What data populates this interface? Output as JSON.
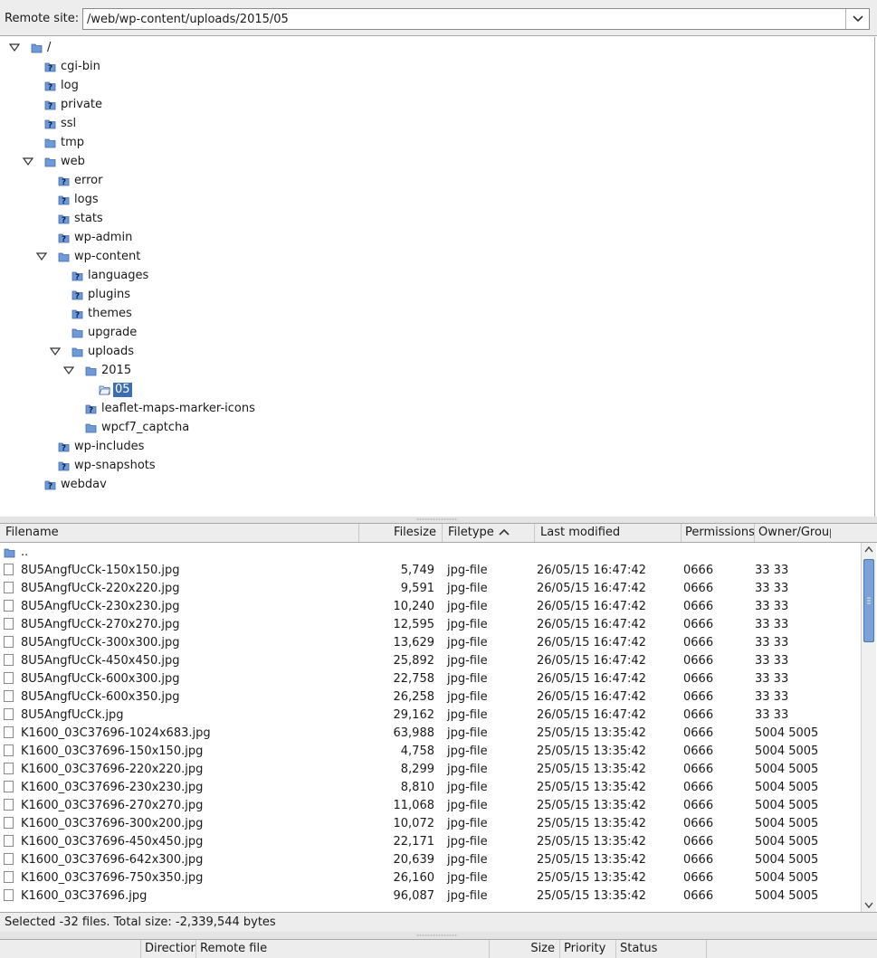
{
  "remote_site": {
    "label": "Remote site:",
    "path": "/web/wp-content/uploads/2015/05"
  },
  "tree": [
    {
      "label": "/",
      "level": 0,
      "expanded": true,
      "icon": "folder-icon"
    },
    {
      "label": "cgi-bin",
      "level": 1,
      "icon": "folder-unknown-icon"
    },
    {
      "label": "log",
      "level": 1,
      "icon": "folder-unknown-icon"
    },
    {
      "label": "private",
      "level": 1,
      "icon": "folder-unknown-icon"
    },
    {
      "label": "ssl",
      "level": 1,
      "icon": "folder-unknown-icon"
    },
    {
      "label": "tmp",
      "level": 1,
      "icon": "folder-icon"
    },
    {
      "label": "web",
      "level": 1,
      "expanded": true,
      "icon": "folder-icon"
    },
    {
      "label": "error",
      "level": 2,
      "icon": "folder-unknown-icon"
    },
    {
      "label": "logs",
      "level": 2,
      "icon": "folder-unknown-icon"
    },
    {
      "label": "stats",
      "level": 2,
      "icon": "folder-unknown-icon"
    },
    {
      "label": "wp-admin",
      "level": 2,
      "icon": "folder-unknown-icon"
    },
    {
      "label": "wp-content",
      "level": 2,
      "expanded": true,
      "icon": "folder-icon"
    },
    {
      "label": "languages",
      "level": 3,
      "icon": "folder-unknown-icon"
    },
    {
      "label": "plugins",
      "level": 3,
      "icon": "folder-unknown-icon"
    },
    {
      "label": "themes",
      "level": 3,
      "icon": "folder-unknown-icon"
    },
    {
      "label": "upgrade",
      "level": 3,
      "icon": "folder-icon"
    },
    {
      "label": "uploads",
      "level": 3,
      "expanded": true,
      "icon": "folder-icon"
    },
    {
      "label": "2015",
      "level": 4,
      "expanded": true,
      "icon": "folder-icon"
    },
    {
      "label": "05",
      "level": 5,
      "selected": true,
      "icon": "folder-open-icon"
    },
    {
      "label": "leaflet-maps-marker-icons",
      "level": 4,
      "icon": "folder-unknown-icon"
    },
    {
      "label": "wpcf7_captcha",
      "level": 4,
      "icon": "folder-icon"
    },
    {
      "label": "wp-includes",
      "level": 2,
      "icon": "folder-unknown-icon"
    },
    {
      "label": "wp-snapshots",
      "level": 2,
      "icon": "folder-unknown-icon"
    },
    {
      "label": "webdav",
      "level": 1,
      "icon": "folder-unknown-icon"
    }
  ],
  "file_list": {
    "columns": {
      "filename": "Filename",
      "filesize": "Filesize",
      "filetype": "Filetype",
      "last_modified": "Last modified",
      "permissions": "Permissions",
      "owner_group": "Owner/Group"
    },
    "parent_row": "..",
    "rows": [
      {
        "name": "8U5AngfUcCk-150x150.jpg",
        "size": "5,749",
        "type": "jpg-file",
        "modified": "26/05/15 16:47:42",
        "perm": "0666",
        "owner": "33 33"
      },
      {
        "name": "8U5AngfUcCk-220x220.jpg",
        "size": "9,591",
        "type": "jpg-file",
        "modified": "26/05/15 16:47:42",
        "perm": "0666",
        "owner": "33 33"
      },
      {
        "name": "8U5AngfUcCk-230x230.jpg",
        "size": "10,240",
        "type": "jpg-file",
        "modified": "26/05/15 16:47:42",
        "perm": "0666",
        "owner": "33 33"
      },
      {
        "name": "8U5AngfUcCk-270x270.jpg",
        "size": "12,595",
        "type": "jpg-file",
        "modified": "26/05/15 16:47:42",
        "perm": "0666",
        "owner": "33 33"
      },
      {
        "name": "8U5AngfUcCk-300x300.jpg",
        "size": "13,629",
        "type": "jpg-file",
        "modified": "26/05/15 16:47:42",
        "perm": "0666",
        "owner": "33 33"
      },
      {
        "name": "8U5AngfUcCk-450x450.jpg",
        "size": "25,892",
        "type": "jpg-file",
        "modified": "26/05/15 16:47:42",
        "perm": "0666",
        "owner": "33 33"
      },
      {
        "name": "8U5AngfUcCk-600x300.jpg",
        "size": "22,758",
        "type": "jpg-file",
        "modified": "26/05/15 16:47:42",
        "perm": "0666",
        "owner": "33 33"
      },
      {
        "name": "8U5AngfUcCk-600x350.jpg",
        "size": "26,258",
        "type": "jpg-file",
        "modified": "26/05/15 16:47:42",
        "perm": "0666",
        "owner": "33 33"
      },
      {
        "name": "8U5AngfUcCk.jpg",
        "size": "29,162",
        "type": "jpg-file",
        "modified": "26/05/15 16:47:42",
        "perm": "0666",
        "owner": "33 33"
      },
      {
        "name": "K1600_03C37696-1024x683.jpg",
        "size": "63,988",
        "type": "jpg-file",
        "modified": "25/05/15 13:35:42",
        "perm": "0666",
        "owner": "5004 5005"
      },
      {
        "name": "K1600_03C37696-150x150.jpg",
        "size": "4,758",
        "type": "jpg-file",
        "modified": "25/05/15 13:35:42",
        "perm": "0666",
        "owner": "5004 5005"
      },
      {
        "name": "K1600_03C37696-220x220.jpg",
        "size": "8,299",
        "type": "jpg-file",
        "modified": "25/05/15 13:35:42",
        "perm": "0666",
        "owner": "5004 5005"
      },
      {
        "name": "K1600_03C37696-230x230.jpg",
        "size": "8,810",
        "type": "jpg-file",
        "modified": "25/05/15 13:35:42",
        "perm": "0666",
        "owner": "5004 5005"
      },
      {
        "name": "K1600_03C37696-270x270.jpg",
        "size": "11,068",
        "type": "jpg-file",
        "modified": "25/05/15 13:35:42",
        "perm": "0666",
        "owner": "5004 5005"
      },
      {
        "name": "K1600_03C37696-300x200.jpg",
        "size": "10,072",
        "type": "jpg-file",
        "modified": "25/05/15 13:35:42",
        "perm": "0666",
        "owner": "5004 5005"
      },
      {
        "name": "K1600_03C37696-450x450.jpg",
        "size": "22,171",
        "type": "jpg-file",
        "modified": "25/05/15 13:35:42",
        "perm": "0666",
        "owner": "5004 5005"
      },
      {
        "name": "K1600_03C37696-642x300.jpg",
        "size": "20,639",
        "type": "jpg-file",
        "modified": "25/05/15 13:35:42",
        "perm": "0666",
        "owner": "5004 5005"
      },
      {
        "name": "K1600_03C37696-750x350.jpg",
        "size": "26,160",
        "type": "jpg-file",
        "modified": "25/05/15 13:35:42",
        "perm": "0666",
        "owner": "5004 5005"
      },
      {
        "name": "K1600_03C37696.jpg",
        "size": "96,087",
        "type": "jpg-file",
        "modified": "25/05/15 13:35:42",
        "perm": "0666",
        "owner": "5004 5005"
      }
    ]
  },
  "status": {
    "text": "Selected -32 files. Total size: -2,339,544 bytes"
  },
  "queue": {
    "columns": {
      "direction": "Direction",
      "remote_file": "Remote file",
      "size": "Size",
      "priority": "Priority",
      "status": "Status"
    }
  },
  "colors": {
    "selection": "#3d6fb0",
    "folder": "#6f9ad8",
    "scroll_thumb": "#7aa2d6"
  }
}
